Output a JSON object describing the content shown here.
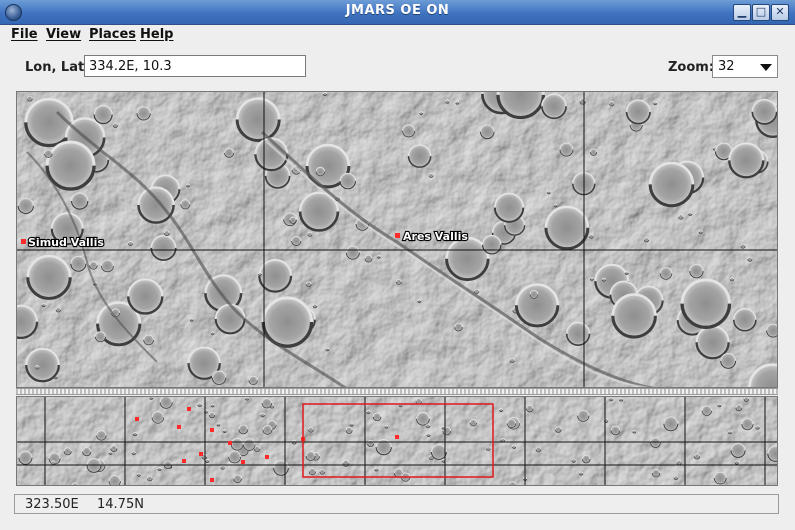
{
  "window": {
    "title": "JMARS OE ON",
    "minimize_glyph": "▁",
    "maximize_glyph": "□",
    "close_glyph": "✕",
    "icon": "globe-icon"
  },
  "menu": [
    {
      "label": "File"
    },
    {
      "label": "View"
    },
    {
      "label": "Places"
    },
    {
      "label": "Help"
    }
  ],
  "location": {
    "label": "Lon, Lat:",
    "value": "334.2E, 10.3"
  },
  "zoom": {
    "label": "Zoom:",
    "value": "32"
  },
  "landmarks": [
    {
      "name": "Simud Vallis"
    },
    {
      "name": "Ares Vallis"
    }
  ],
  "status": {
    "lon": "323.50E",
    "lat": "14.75N"
  },
  "colors": {
    "landmark_marker": "#ff2a2a",
    "viewport_box": "#e0191b",
    "terrain_base": "#9a9a9a"
  }
}
